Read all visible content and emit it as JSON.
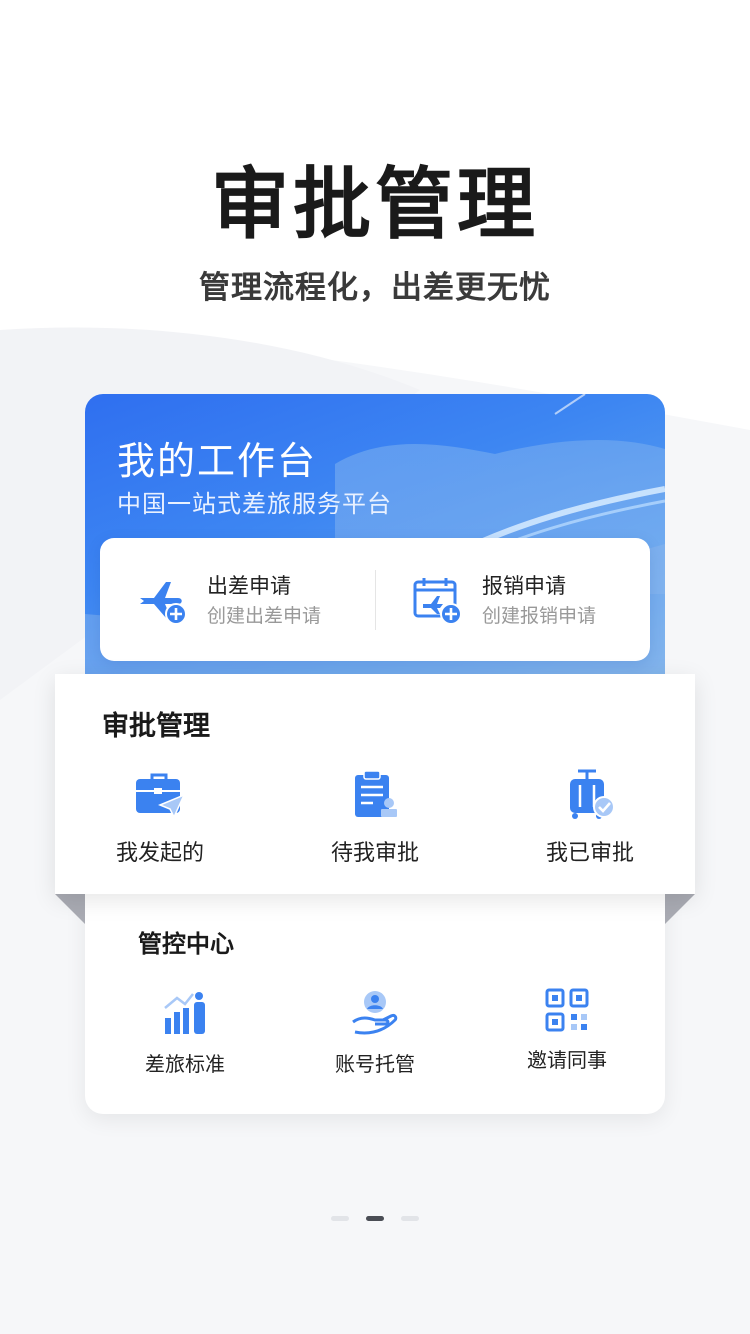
{
  "hero": {
    "title": "审批管理",
    "subtitle": "管理流程化，出差更无忧"
  },
  "banner": {
    "title": "我的工作台",
    "subtitle": "中国一站式差旅服务平台",
    "quick_actions": [
      {
        "label": "出差申请",
        "sub": "创建出差申请",
        "icon": "plane-add-icon"
      },
      {
        "label": "报销申请",
        "sub": "创建报销申请",
        "icon": "calendar-plane-add-icon"
      }
    ]
  },
  "approval": {
    "title": "审批管理",
    "items": [
      {
        "label": "我发起的",
        "icon": "briefcase-send-icon"
      },
      {
        "label": "待我审批",
        "icon": "clipboard-stamp-icon"
      },
      {
        "label": "我已审批",
        "icon": "luggage-check-icon"
      }
    ]
  },
  "control": {
    "title": "管控中心",
    "items": [
      {
        "label": "差旅标准",
        "icon": "growth-person-icon"
      },
      {
        "label": "账号托管",
        "icon": "hand-user-icon"
      },
      {
        "label": "邀请同事",
        "icon": "qr-code-icon"
      }
    ]
  },
  "pager": {
    "active_index": 1,
    "count": 3
  },
  "colors": {
    "accent": "#2f6ff0",
    "icon_blue": "#3b82f0",
    "icon_light": "#a8c8f7"
  }
}
